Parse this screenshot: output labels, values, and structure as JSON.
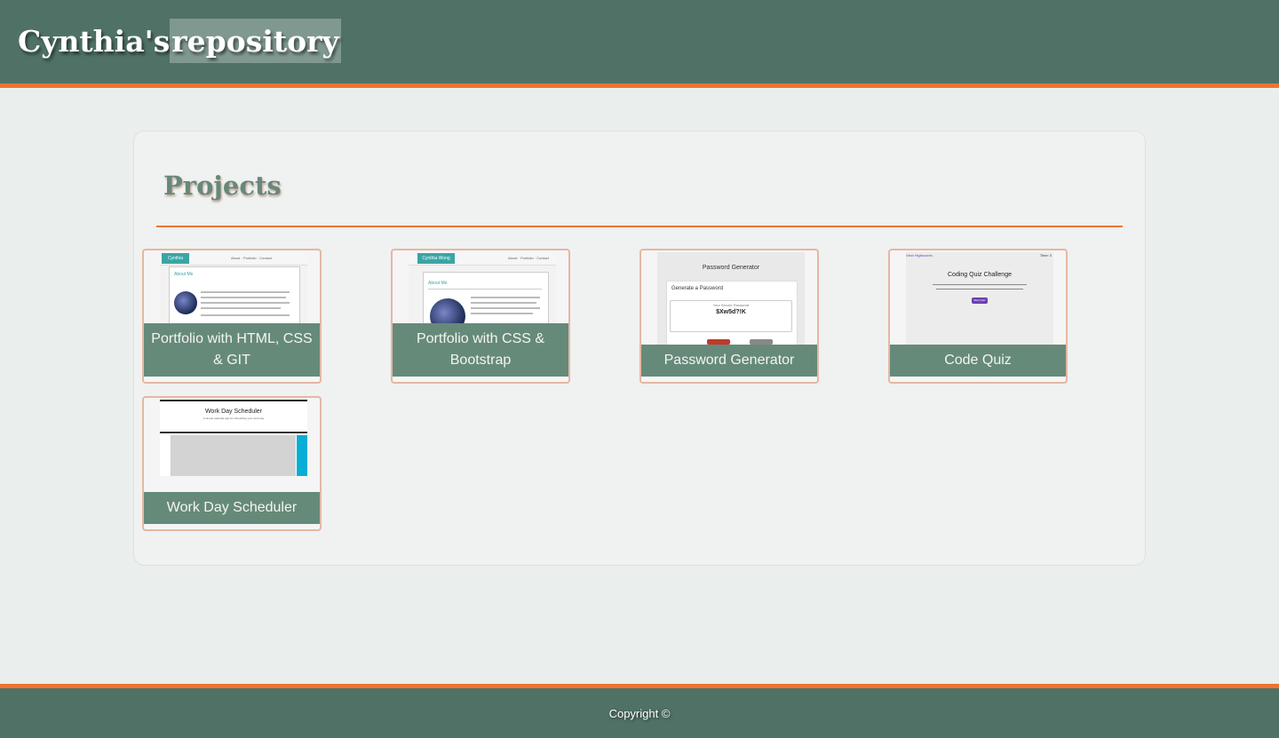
{
  "header": {
    "title_part1": "Cynthia's ",
    "title_part2": "repository"
  },
  "projects": {
    "title": "Projects",
    "items": [
      {
        "label": "Portfolio with HTML, CSS & GIT",
        "thumb": {
          "brand": "Cynthia Wong",
          "nav": "About · Portfolio · Contact",
          "heading": "About Me"
        }
      },
      {
        "label": "Portfolio with CSS & Bootstrap",
        "thumb": {
          "brand": "Cynthia Wong",
          "nav": "About · Portfolio · Contact",
          "heading": "About Me"
        }
      },
      {
        "label": "Password Generator",
        "thumb": {
          "title": "Password Generator",
          "subtitle": "Generate a Password",
          "hint": "Your Secure Password",
          "password": "$Xw5d?!K"
        }
      },
      {
        "label": "Code Quiz",
        "thumb": {
          "link": "View Highscores",
          "timer": "Time: 0",
          "title": "Coding Quiz Challenge",
          "button": "Start Quiz"
        }
      },
      {
        "label": "Work Day Scheduler",
        "thumb": {
          "title": "Work Day Scheduler",
          "subtitle": "A simple calendar app for scheduling your work day"
        }
      }
    ]
  },
  "footer": {
    "text": "Copyright ©"
  },
  "colors": {
    "header_bg": "#507266",
    "accent": "#ef7431",
    "card_caption_bg": "#668a79",
    "section_title": "#66887b"
  }
}
